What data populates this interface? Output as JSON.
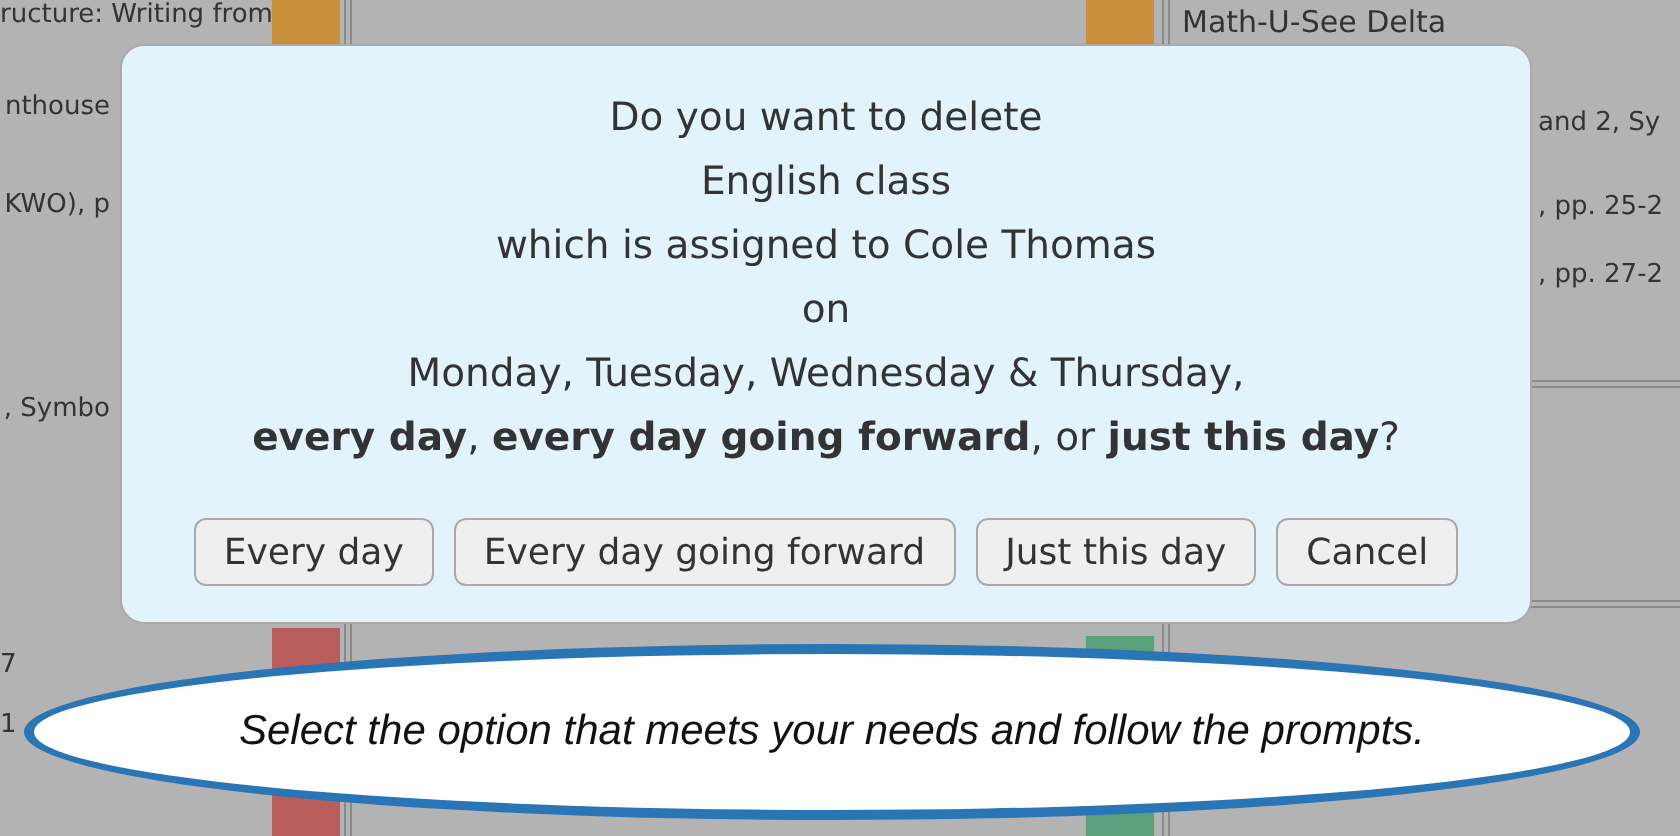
{
  "background": {
    "left_texts": [
      "ructure: Writing from",
      "nthouse",
      "KWO), p",
      ", Symbo",
      "7",
      "1"
    ],
    "right_texts": [
      "Math-U-See Delta",
      "and 2, Sy",
      ", pp. 25-2",
      ", pp. 27-2"
    ],
    "stripes": [
      {
        "color": "#c98f3a"
      },
      {
        "color": "#b85c5c"
      },
      {
        "color": "#c98f3a"
      },
      {
        "color": "#5aa07a"
      }
    ]
  },
  "dialog": {
    "lines": [
      "Do you want to delete",
      "English class",
      "which is assigned to Cole Thomas",
      "on",
      "Monday, Tuesday, Wednesday & Thursday,",
      "**every day**, **every day going forward**, or **just this day**?"
    ],
    "buttons": [
      "Every day",
      "Every day going forward",
      "Just this day",
      "Cancel"
    ]
  },
  "callout": {
    "text": "Select the option that meets your needs and follow the prompts."
  }
}
